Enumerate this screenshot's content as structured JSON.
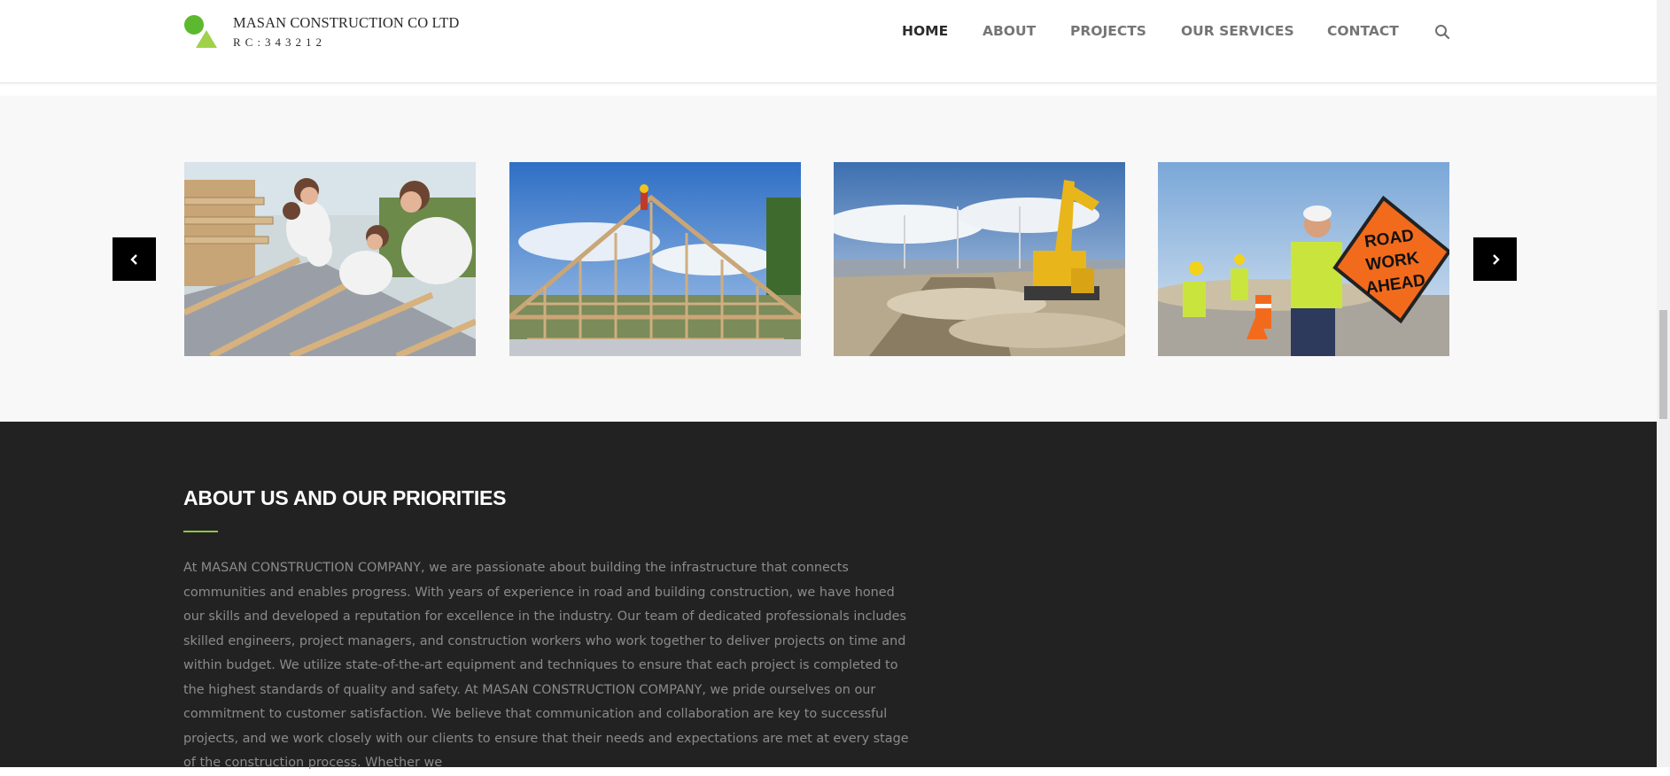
{
  "header": {
    "brand_title": "MASAN CONSTRUCTION CO LTD",
    "brand_rc": "RC:343212",
    "nav": [
      {
        "label": "HOME",
        "active": true
      },
      {
        "label": "ABOUT",
        "active": false
      },
      {
        "label": "PROJECTS",
        "active": false
      },
      {
        "label": "OUR SERVICES",
        "active": false
      },
      {
        "label": "CONTACT",
        "active": false
      }
    ],
    "search_icon": "search-icon"
  },
  "gallery": {
    "images": [
      {
        "name": "workers-building-wood-frame",
        "alt": "Team of workers assembling a wooden floor frame"
      },
      {
        "name": "house-timber-framing",
        "alt": "House under construction with timber framing"
      },
      {
        "name": "excavator-roadworks",
        "alt": "Yellow excavator working on a road site"
      },
      {
        "name": "road-work-ahead-sign",
        "alt": "Workers placing a ROAD WORK AHEAD sign"
      }
    ],
    "sign_text": [
      "ROAD",
      "WORK",
      "AHEAD"
    ],
    "prev_icon": "chevron-left-icon",
    "next_icon": "chevron-right-icon"
  },
  "about": {
    "title": "ABOUT US AND OUR PRIORITIES",
    "body": "At MASAN CONSTRUCTION COMPANY, we are passionate about building the infrastructure that connects communities and enables progress. With years of experience in road and building construction, we have honed our skills and developed a reputation for excellence in the industry. Our team of dedicated professionals includes skilled engineers, project managers, and construction workers who work together to deliver projects on time and within budget. We utilize state-of-the-art equipment and techniques to ensure that each project is completed to the highest standards of quality and safety. At MASAN CONSTRUCTION COMPANY, we pride ourselves on our commitment to customer satisfaction. We believe that communication and collaboration are key to successful projects, and we work closely with our clients to ensure that their needs and expectations are met at every stage of the construction process. Whether we"
  },
  "colors": {
    "accent": "#8dc63f",
    "dark_section": "#222222",
    "gallery_bg": "#f8f8f8",
    "nav_active": "#2b2b2b",
    "nav_inactive": "#757575"
  }
}
